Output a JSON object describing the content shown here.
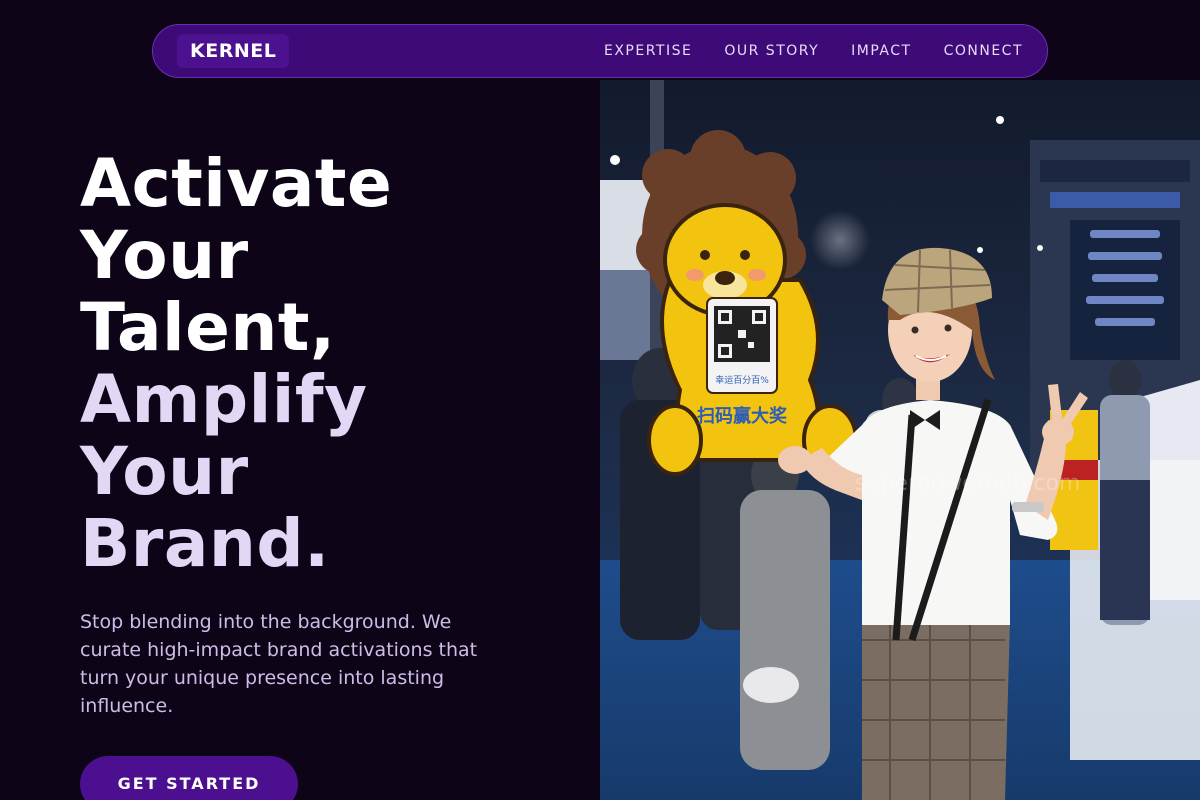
{
  "brand": {
    "logo": "KERNEL"
  },
  "nav": {
    "links": [
      "EXPERTISE",
      "OUR STORY",
      "IMPACT",
      "CONNECT"
    ]
  },
  "hero": {
    "headline_lines": [
      "Activate",
      "Your",
      "Talent,",
      "Amplify",
      "Your",
      "Brand."
    ],
    "subtitle": "Stop blending into the background. We curate high-impact brand activations that turn your unique presence into lasting influence.",
    "cta_label": "GET STARTED"
  },
  "image": {
    "sign_text_line1": "幸运百分百%",
    "sign_text_line2": "扫码赢大奖",
    "watermark": "superpowerhub.com",
    "description_icon": "photo-person-holding-mascot-sign"
  },
  "colors": {
    "background": "#0e0418",
    "nav_bg": "#3d0a78",
    "accent": "#4b0f8f",
    "headline_primary": "#ffffff",
    "headline_secondary": "#e2d8f5",
    "subtitle": "#cdbde6"
  }
}
